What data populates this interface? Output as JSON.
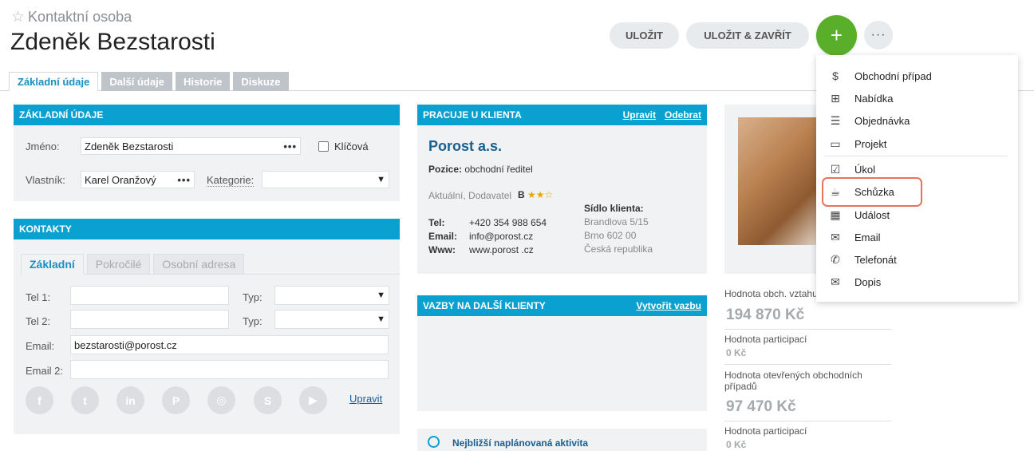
{
  "header": {
    "entity_type": "Kontaktní osoba",
    "title": "Zdeněk Bezstarosti",
    "save_label": "ULOŽIT",
    "save_close_label": "ULOŽIT & ZAVŘÍT",
    "add_label": "+",
    "more_label": "···"
  },
  "tabs": [
    {
      "label": "Základní údaje"
    },
    {
      "label": "Další údaje"
    },
    {
      "label": "Historie"
    },
    {
      "label": "Diskuze"
    }
  ],
  "basic": {
    "title": "ZÁKLADNÍ ÚDAJE",
    "name_label": "Jméno:",
    "name_value": "Zdeněk Bezstarosti",
    "key_label": "Klíčová",
    "owner_label": "Vlastník:",
    "owner_value": "Karel Oranžový",
    "category_label": "Kategorie:",
    "category_value": ""
  },
  "contacts": {
    "title": "KONTAKTY",
    "subtabs": [
      {
        "label": "Základní"
      },
      {
        "label": "Pokročilé"
      },
      {
        "label": "Osobní adresa"
      }
    ],
    "tel1_label": "Tel 1:",
    "tel1_value": "",
    "tel2_label": "Tel 2:",
    "tel2_value": "",
    "type_label": "Typ:",
    "email_label": "Email:",
    "email_value": "bezstarosti@porost.cz",
    "email2_label": "Email 2:",
    "email2_value": "",
    "social": [
      {
        "name": "facebook-icon",
        "glyph": "f"
      },
      {
        "name": "twitter-icon",
        "glyph": "t"
      },
      {
        "name": "linkedin-icon",
        "glyph": "in"
      },
      {
        "name": "pinterest-icon",
        "glyph": "P"
      },
      {
        "name": "instagram-icon",
        "glyph": "◎"
      },
      {
        "name": "skype-icon",
        "glyph": "S"
      },
      {
        "name": "youtube-icon",
        "glyph": "▶"
      }
    ],
    "edit_label": "Upravit"
  },
  "client": {
    "title": "PRACUJE U KLIENTA",
    "edit_label": "Upravit",
    "remove_label": "Odebrat",
    "name": "Porost a.s.",
    "position_label": "Pozice:",
    "position_value": "obchodní ředitel",
    "status": "Aktuální, Dodavatel",
    "rating_letter": "B",
    "rating_stars": "★★☆",
    "seat_label": "Sídlo klienta:",
    "tel_label": "Tel:",
    "tel_value": "+420 354 988 654",
    "email_label": "Email:",
    "email_value": "info@porost.cz",
    "www_label": "Www:",
    "www_value": "www.porost .cz",
    "street": "Brandlova 5/15",
    "city": "Brno 602 00",
    "country": "Česká republika"
  },
  "relations": {
    "title": "VAZBY NA DALŠÍ KLIENTY",
    "create_label": "Vytvořit vazbu"
  },
  "activity": {
    "label": "Nejbližší naplánovaná aktivita"
  },
  "stats": [
    {
      "label": "Hodnota obch. vztahu",
      "value": "194 870 Kč"
    },
    {
      "label": "Hodnota participací",
      "value": "0 Kč"
    },
    {
      "label": "Hodnota otevřených obchodních případů",
      "value": "97 470 Kč"
    },
    {
      "label": "Hodnota participací",
      "value": "0 Kč"
    }
  ],
  "menu": [
    {
      "label": "Obchodní případ",
      "icon": "dollar-icon",
      "glyph": "$"
    },
    {
      "label": "Nabídka",
      "icon": "offer-icon",
      "glyph": "⊞"
    },
    {
      "label": "Objednávka",
      "icon": "order-icon",
      "glyph": "☰"
    },
    {
      "label": "Projekt",
      "icon": "folder-icon",
      "glyph": "▭"
    },
    {
      "label": "Úkol",
      "icon": "task-icon",
      "glyph": "☑"
    },
    {
      "label": "Schůzka",
      "icon": "cup-icon",
      "glyph": "☕"
    },
    {
      "label": "Událost",
      "icon": "calendar-icon",
      "glyph": "▦"
    },
    {
      "label": "Email",
      "icon": "envelope-icon",
      "glyph": "✉"
    },
    {
      "label": "Telefonát",
      "icon": "phone-icon",
      "glyph": "✆"
    },
    {
      "label": "Dopis",
      "icon": "letter-icon",
      "glyph": "✉"
    }
  ]
}
